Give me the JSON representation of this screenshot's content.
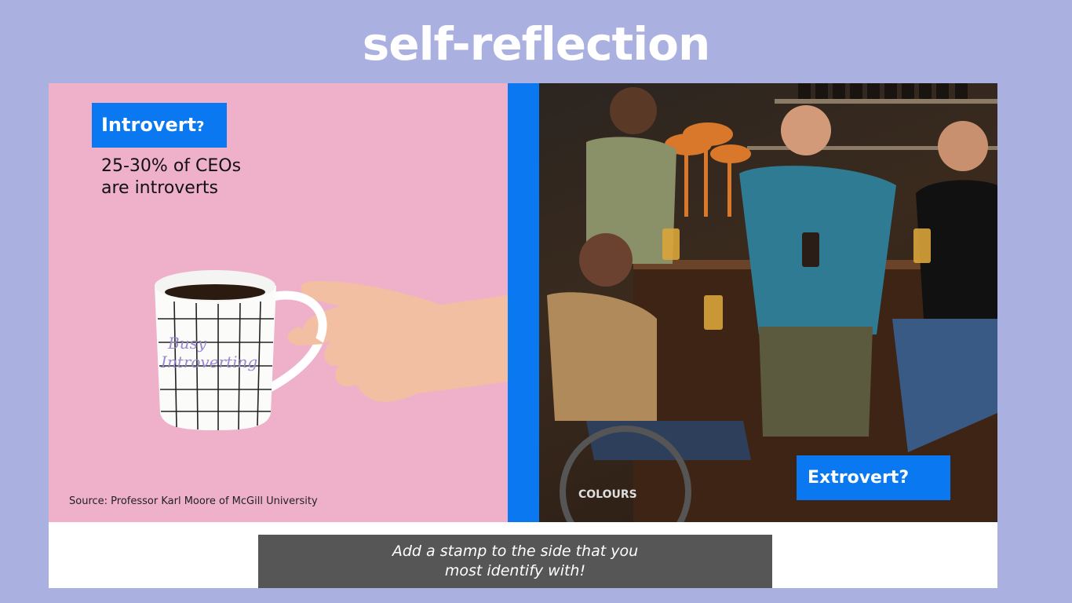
{
  "title": "self-reflection",
  "left": {
    "label": "Introvert",
    "label_suffix": "?",
    "stat_line1": "25-30% of CEOs",
    "stat_line2": "are introverts",
    "mug_text_line1": "Busy",
    "mug_text_line2": "Introverting",
    "source": "Source: Professor Karl Moore of McGill University"
  },
  "right": {
    "label": "Extrovert?",
    "wheel_text": "COLOURS"
  },
  "caption": "Add a stamp to the side that you most identify with!",
  "colors": {
    "background": "#aab0e0",
    "accent_blue": "#0a78f0",
    "pink": "#eeb1c9",
    "caption_bg": "#565656"
  }
}
